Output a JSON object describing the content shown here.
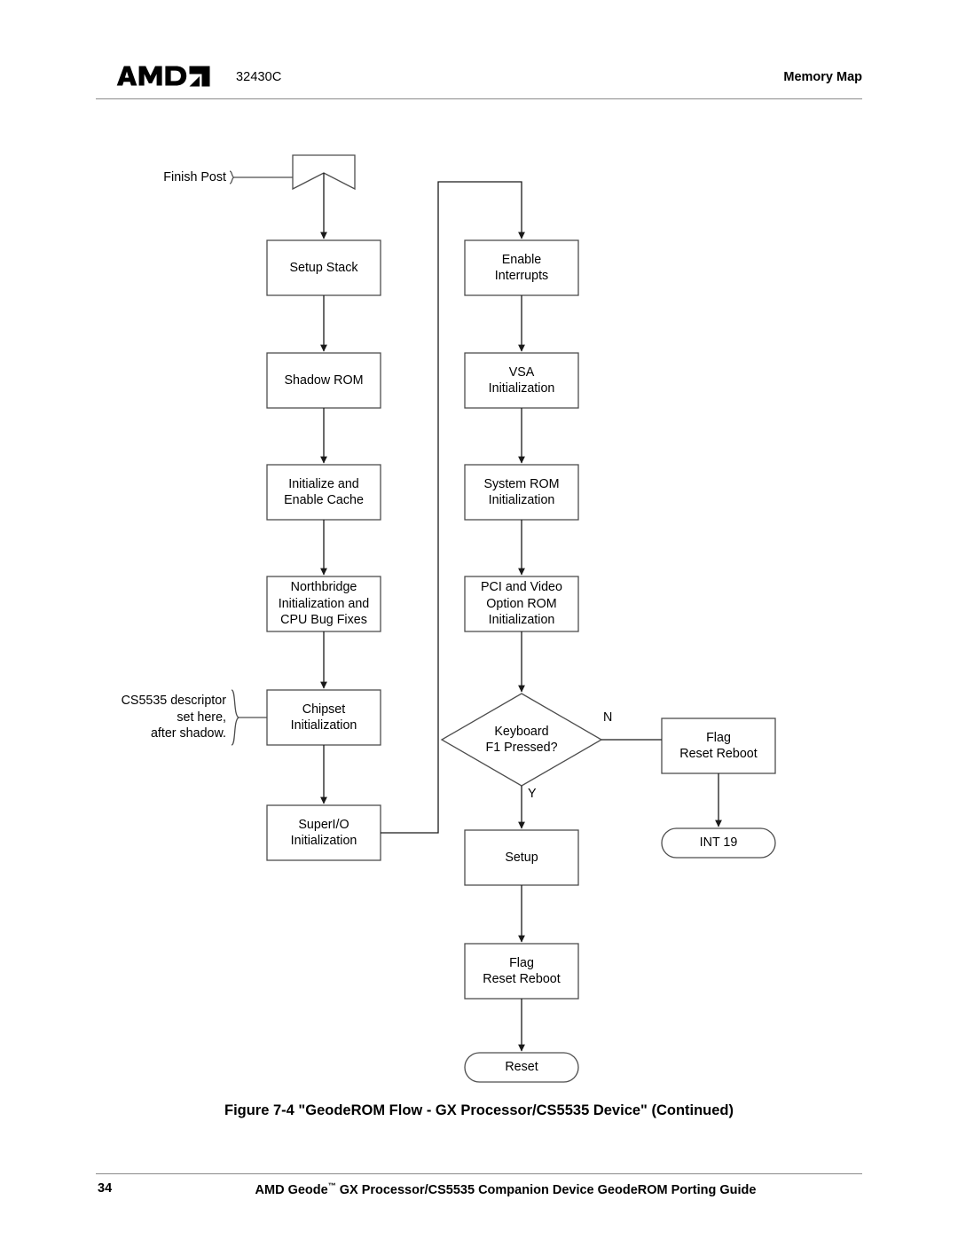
{
  "header": {
    "logo_text": "AMD",
    "logo_name": "amd-logo",
    "doc_number": "32430C",
    "section": "Memory Map"
  },
  "figure": {
    "caption": "Figure 7-4 \"GeodeROM Flow - GX Processor/CS5535 Device\" (Continued)"
  },
  "footer": {
    "page_number": "34",
    "title_before_tm": "AMD Geode",
    "tm": "™",
    "title_after_tm": " GX Processor/CS5535 Companion Device GeodeROM Porting Guide"
  },
  "flowchart": {
    "title": "GeodeROM Flow - GX Processor/CS5535 Device",
    "nodes": [
      {
        "id": "finish-post-connector",
        "label": "",
        "shape": "banner",
        "column": "left"
      },
      {
        "id": "setup-stack",
        "label": "Setup Stack",
        "shape": "process",
        "column": "left"
      },
      {
        "id": "shadow-rom",
        "label": "Shadow ROM",
        "shape": "process",
        "column": "left"
      },
      {
        "id": "initialize-enable-cache",
        "label": "Initialize and\nEnable Cache",
        "shape": "process",
        "column": "left"
      },
      {
        "id": "northbridge-init",
        "label": "Northbridge\nInitialization and\nCPU Bug Fixes",
        "shape": "process",
        "column": "left"
      },
      {
        "id": "chipset-init",
        "label": "Chipset\nInitialization",
        "shape": "process",
        "column": "left"
      },
      {
        "id": "superio-init",
        "label": "SuperI/O\nInitialization",
        "shape": "process",
        "column": "left"
      },
      {
        "id": "enable-interrupts",
        "label": "Enable\nInterrupts",
        "shape": "process",
        "column": "right"
      },
      {
        "id": "vsa-init",
        "label": "VSA\nInitialization",
        "shape": "process",
        "column": "right"
      },
      {
        "id": "system-rom-init",
        "label": "System ROM\nInitialization",
        "shape": "process",
        "column": "right"
      },
      {
        "id": "pci-video-option-rom-init",
        "label": "PCI and Video\nOption ROM\nInitialization",
        "shape": "process",
        "column": "right"
      },
      {
        "id": "keyboard-f1-pressed",
        "label": "Keyboard\nF1 Pressed?",
        "shape": "decision",
        "column": "right"
      },
      {
        "id": "setup",
        "label": "Setup",
        "shape": "process",
        "column": "right"
      },
      {
        "id": "flag-reset-reboot-main",
        "label": "Flag\nReset Reboot",
        "shape": "process",
        "column": "right"
      },
      {
        "id": "reset",
        "label": "Reset",
        "shape": "terminator",
        "column": "right"
      },
      {
        "id": "flag-reset-reboot-branch",
        "label": "Flag\nReset Reboot",
        "shape": "process",
        "column": "far-right"
      },
      {
        "id": "int-19",
        "label": "INT 19",
        "shape": "terminator",
        "column": "far-right"
      }
    ],
    "annotations": [
      {
        "id": "finish-post",
        "text": "Finish Post",
        "target": "finish-post-connector"
      },
      {
        "id": "cs5535-descriptor-note",
        "text": "CS5535 descriptor\nset here,\nafter shadow.",
        "target": "chipset-init"
      }
    ],
    "edge_labels": [
      {
        "id": "branch-no",
        "text": "N",
        "from": "keyboard-f1-pressed",
        "to": "flag-reset-reboot-branch"
      },
      {
        "id": "branch-yes",
        "text": "Y",
        "from": "keyboard-f1-pressed",
        "to": "setup"
      }
    ],
    "colors": {
      "stroke": "#4d4d4d",
      "text": "#000000",
      "background": "#ffffff",
      "rule": "#8b8b8b"
    }
  }
}
